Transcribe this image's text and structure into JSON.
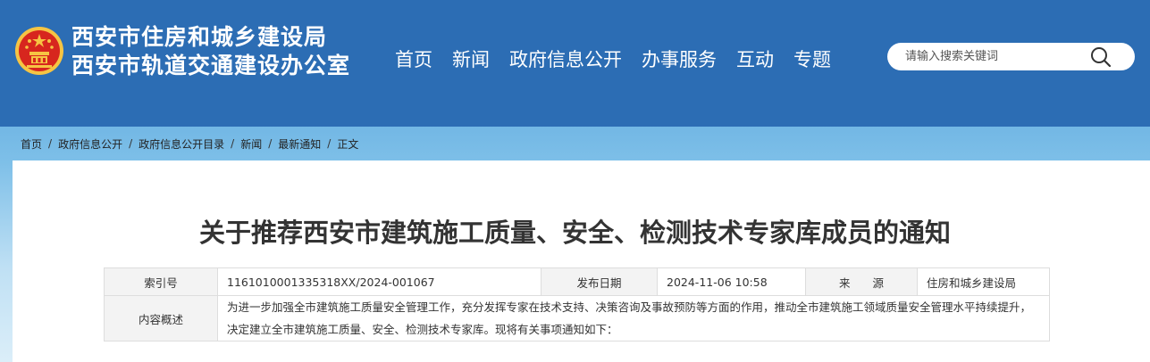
{
  "header": {
    "title_line1": "西安市住房和城乡建设局",
    "title_line2": "西安市轨道交通建设办公室",
    "emblem_icon": "national-emblem-icon"
  },
  "nav": {
    "items": [
      {
        "label": "首页"
      },
      {
        "label": "新闻"
      },
      {
        "label": "政府信息公开"
      },
      {
        "label": "办事服务"
      },
      {
        "label": "互动"
      },
      {
        "label": "专题"
      }
    ]
  },
  "search": {
    "placeholder": "请输入搜索关键词",
    "icon": "search-icon"
  },
  "breadcrumb": {
    "items": [
      "首页",
      "政府信息公开",
      "政府信息公开目录",
      "新闻",
      "最新通知",
      "正文"
    ],
    "separator": "/"
  },
  "article": {
    "title": "关于推荐西安市建筑施工质量、安全、检测技术专家库成员的通知"
  },
  "meta": {
    "index_label": "索引号",
    "index_value": "1161010001335318XX/2024-001067",
    "date_label": "发布日期",
    "date_value": "2024-11-06 10:58",
    "source_label": "来　　源",
    "source_value": "住房和城乡建设局",
    "summary_label": "内容概述",
    "summary_value": "为进一步加强全市建筑施工质量安全管理工作，充分发挥专家在技术支持、决策咨询及事故预防等方面的作用，推动全市建筑施工领域质量安全管理水平持续提升，决定建立全市建筑施工质量、安全、检测技术专家库。现将有关事项通知如下："
  },
  "colors": {
    "header_bg": "#2c6db4",
    "emblem_red": "#d7261e",
    "emblem_gold": "#f6c443"
  }
}
